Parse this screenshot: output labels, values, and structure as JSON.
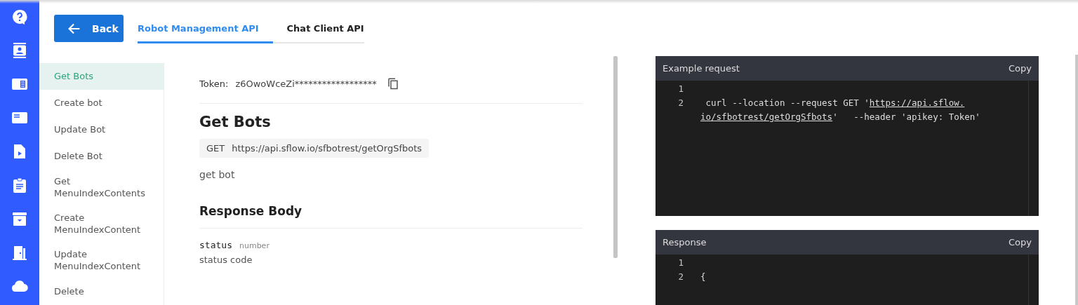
{
  "rail": {
    "icons": [
      {
        "kind": "help"
      },
      {
        "kind": "contact"
      },
      {
        "kind": "news"
      },
      {
        "kind": "card"
      },
      {
        "kind": "file"
      },
      {
        "kind": "clipboard"
      },
      {
        "kind": "archive"
      },
      {
        "kind": "door"
      },
      {
        "kind": "cloud"
      }
    ]
  },
  "back_button": {
    "label": "Back"
  },
  "tabs": [
    {
      "label": "Robot Management API",
      "selected": true
    },
    {
      "label": "Chat Client API",
      "selected": false
    }
  ],
  "nav": [
    {
      "label": "Get Bots",
      "selected": true
    },
    {
      "label": "Create bot",
      "selected": false
    },
    {
      "label": "Update Bot",
      "selected": false
    },
    {
      "label": "Delete Bot",
      "selected": false
    },
    {
      "label": "Get MenuIndexContents",
      "selected": false
    },
    {
      "label": "Create MenuIndexContent",
      "selected": false
    },
    {
      "label": "Update MenuIndexContent",
      "selected": false
    },
    {
      "label": "Delete",
      "selected": false
    }
  ],
  "token": {
    "label": "Token:",
    "value": "z6OwoWceZi******************"
  },
  "endpoint": {
    "title": "Get Bots",
    "method": "GET",
    "url": "https://api.sflow.io/sfbotrest/getOrgSfbots",
    "description": "get bot"
  },
  "response_body": {
    "title": "Response Body",
    "fields": [
      {
        "name": "status",
        "type": "number",
        "description": "status code"
      }
    ]
  },
  "example_request": {
    "title": "Example request",
    "copy": "Copy",
    "lines": [
      {
        "number": "1"
      },
      {
        "number": "2",
        "text": " curl --location --request GET '",
        "link": "https://api.sflow.",
        "wrap_link": "io/sfbotrest/getOrgSfbots",
        "after": "'   --header 'apikey: Token'"
      }
    ]
  },
  "response": {
    "title": "Response",
    "copy": "Copy",
    "lines": [
      {
        "number": "1"
      },
      {
        "number": "2",
        "text": "{"
      }
    ]
  }
}
